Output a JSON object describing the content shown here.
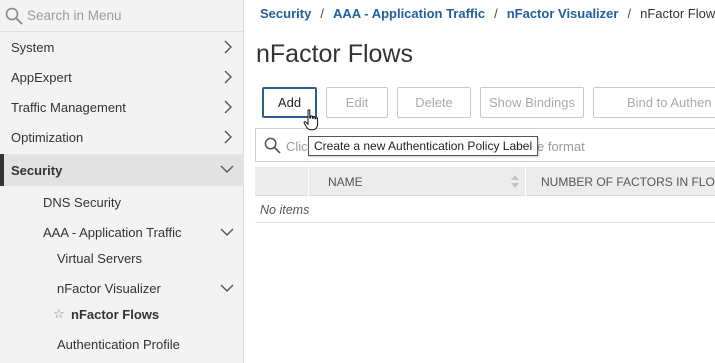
{
  "sidebar": {
    "search_placeholder": "Search in Menu",
    "items": [
      {
        "label": "System"
      },
      {
        "label": "AppExpert"
      },
      {
        "label": "Traffic Management"
      },
      {
        "label": "Optimization"
      },
      {
        "label": "Security"
      }
    ],
    "security_children": [
      {
        "label": "DNS Security"
      },
      {
        "label": "AAA - Application Traffic"
      },
      {
        "label": "Virtual Servers"
      },
      {
        "label": "nFactor Visualizer"
      },
      {
        "label": "nFactor Flows"
      },
      {
        "label": "Authentication Profile"
      }
    ]
  },
  "breadcrumb": {
    "items": [
      "Security",
      "AAA - Application Traffic",
      "nFactor Visualizer"
    ],
    "current": "nFactor Flows",
    "separator": "/"
  },
  "page": {
    "title": "nFactor Flows"
  },
  "toolbar": {
    "add": "Add",
    "edit": "Edit",
    "delete": "Delete",
    "show_bindings": "Show Bindings",
    "bind_to_authentication": "Bind to Authen"
  },
  "tooltip": "Create a new Authentication Policy Label",
  "search": {
    "placeholder_start": "Click",
    "placeholder_end": "e format"
  },
  "table": {
    "columns": [
      "NAME",
      "NUMBER OF FACTORS IN FLOW"
    ],
    "empty_text": "No items"
  },
  "colors": {
    "link": "#1f5f9c",
    "primary_border": "#2a5e8f",
    "sidebar_bg": "#f3f3f3"
  }
}
